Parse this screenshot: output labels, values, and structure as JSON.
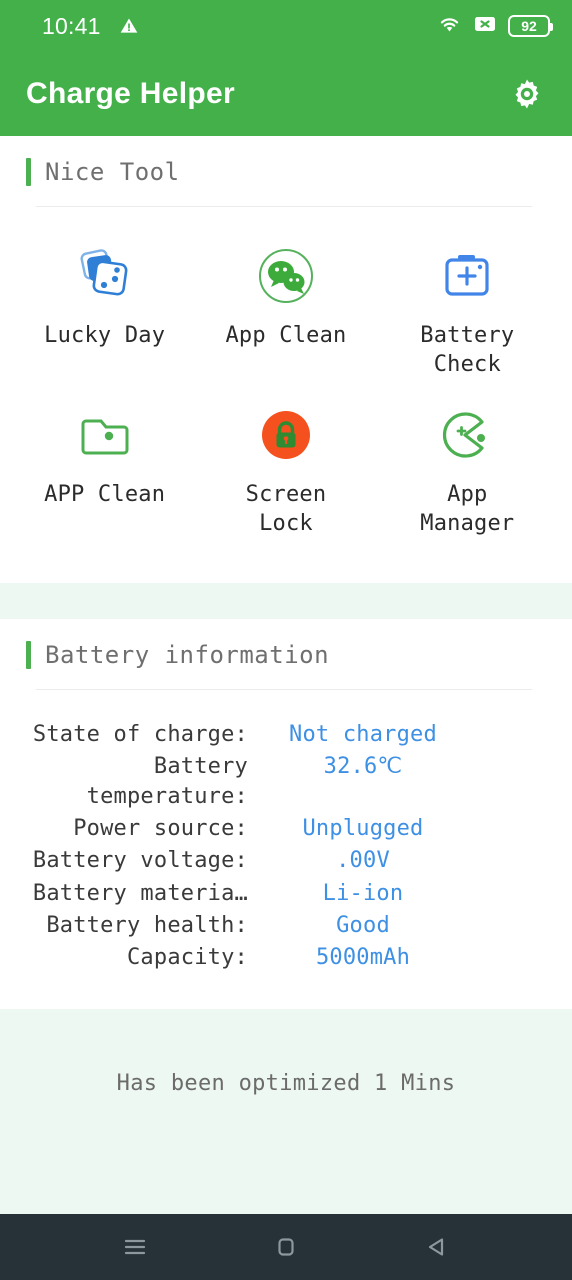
{
  "statusbar": {
    "clock": "10:41",
    "warning_icon": "warning-triangle-icon",
    "wifi_icon": "wifi-icon",
    "signal_icon": "signal-off-icon",
    "battery_icon": "battery-icon",
    "battery_level": "92"
  },
  "appbar": {
    "title": "Charge Helper",
    "settings_icon": "gear-icon"
  },
  "tools_section": {
    "title": "Nice Tool",
    "items": [
      {
        "label": "Lucky\nDay",
        "icon": "dice-icon"
      },
      {
        "label": "App\nClean",
        "icon": "chat-bubbles-icon"
      },
      {
        "label": "Battery\nCheck",
        "icon": "battery-plus-icon"
      },
      {
        "label": "APP\nClean",
        "icon": "folder-icon"
      },
      {
        "label": "Screen\nLock",
        "icon": "padlock-icon"
      },
      {
        "label": "App\nManager",
        "icon": "pacman-icon"
      }
    ]
  },
  "battery_section": {
    "title": "Battery information",
    "rows": [
      {
        "label": "State of charge:",
        "value": "Not charged"
      },
      {
        "label": "Battery\ntemperature:",
        "value": "32.6℃"
      },
      {
        "label": "Power source:",
        "value": "Unplugged"
      },
      {
        "label": "Battery voltage:",
        "value": ".00V"
      },
      {
        "label": "Battery materia…",
        "value": "Li-ion"
      },
      {
        "label": "Battery health:",
        "value": "Good"
      },
      {
        "label": "Capacity:",
        "value": "5000mAh"
      }
    ]
  },
  "footer": {
    "optimized_text": "Has been optimized 1 Mins"
  },
  "navbar": {
    "recents_icon": "menu-icon",
    "home_icon": "home-square-icon",
    "back_icon": "back-triangle-icon"
  },
  "colors": {
    "brand_green": "#43b04a",
    "accent_green": "#4caf50",
    "value_blue": "#3d90e3",
    "page_mint": "#eef8f2",
    "navbar_dark": "#263238"
  }
}
